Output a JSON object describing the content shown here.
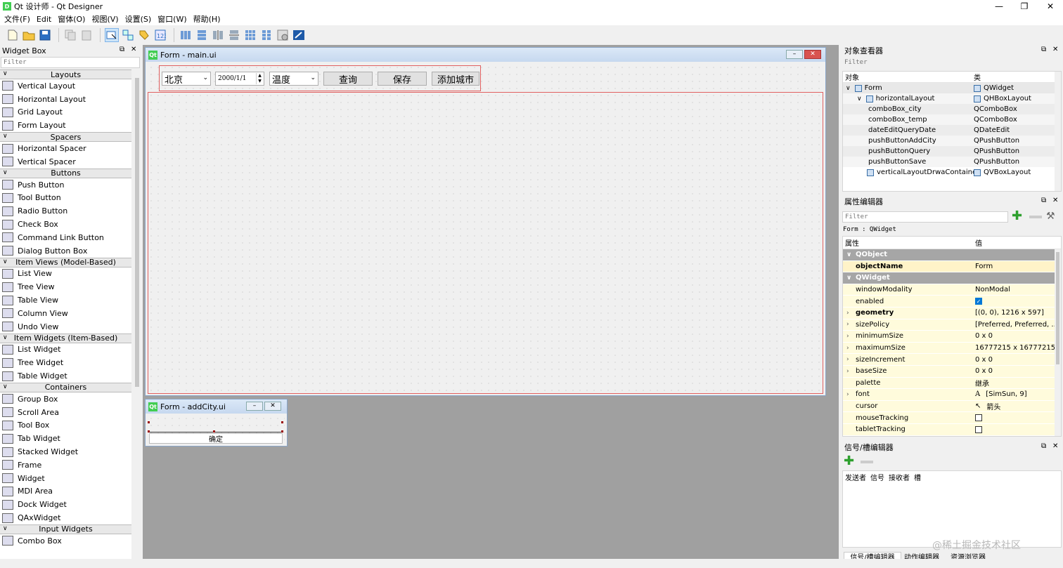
{
  "window": {
    "title": "Qt 设计师 - Qt Designer",
    "app_icon": "D",
    "minimize": "—",
    "restore": "❐",
    "close": "✕"
  },
  "menu": [
    "文件(F)",
    "Edit",
    "窗体(O)",
    "视图(V)",
    "设置(S)",
    "窗口(W)",
    "帮助(H)"
  ],
  "widget_box": {
    "title": "Widget Box",
    "filter_placeholder": "Filter",
    "categories": [
      {
        "name": "Layouts",
        "items": [
          "Vertical Layout",
          "Horizontal Layout",
          "Grid Layout",
          "Form Layout"
        ]
      },
      {
        "name": "Spacers",
        "items": [
          "Horizontal Spacer",
          "Vertical Spacer"
        ]
      },
      {
        "name": "Buttons",
        "items": [
          "Push Button",
          "Tool Button",
          "Radio Button",
          "Check Box",
          "Command Link Button",
          "Dialog Button Box"
        ]
      },
      {
        "name": "Item Views (Model-Based)",
        "items": [
          "List View",
          "Tree View",
          "Table View",
          "Column View",
          "Undo View"
        ]
      },
      {
        "name": "Item Widgets (Item-Based)",
        "items": [
          "List Widget",
          "Tree Widget",
          "Table Widget"
        ]
      },
      {
        "name": "Containers",
        "items": [
          "Group Box",
          "Scroll Area",
          "Tool Box",
          "Tab Widget",
          "Stacked Widget",
          "Frame",
          "Widget",
          "MDI Area",
          "Dock Widget",
          "QAxWidget"
        ]
      },
      {
        "name": "Input Widgets",
        "items": [
          "Combo Box"
        ]
      }
    ]
  },
  "main_form": {
    "title": "Form - main.ui",
    "combo_city": "北京",
    "date_edit": "2000/1/1",
    "combo_temp": "温度",
    "btn_query": "查询",
    "btn_save": "保存",
    "btn_add_city": "添加城市"
  },
  "add_city_form": {
    "title": "Form - addCity.ui",
    "btn_ok": "确定"
  },
  "object_inspector": {
    "title": "对象查看器",
    "filter_placeholder": "Filter",
    "col_object": "对象",
    "col_class": "类",
    "rows": [
      {
        "name": "Form",
        "class": "QWidget",
        "depth": 0,
        "arrow": "∨"
      },
      {
        "name": "horizontalLayout",
        "class": "QHBoxLayout",
        "depth": 1,
        "arrow": "∨"
      },
      {
        "name": "comboBox_city",
        "class": "QComboBox",
        "depth": 2,
        "arrow": ""
      },
      {
        "name": "comboBox_temp",
        "class": "QComboBox",
        "depth": 2,
        "arrow": ""
      },
      {
        "name": "dateEditQueryDate",
        "class": "QDateEdit",
        "depth": 2,
        "arrow": ""
      },
      {
        "name": "pushButtonAddCity",
        "class": "QPushButton",
        "depth": 2,
        "arrow": ""
      },
      {
        "name": "pushButtonQuery",
        "class": "QPushButton",
        "depth": 2,
        "arrow": ""
      },
      {
        "name": "pushButtonSave",
        "class": "QPushButton",
        "depth": 2,
        "arrow": ""
      },
      {
        "name": "verticalLayoutDrwaContainer",
        "class": "QVBoxLayout",
        "depth": 1,
        "arrow": ""
      }
    ]
  },
  "property_editor": {
    "title": "属性编辑器",
    "filter_placeholder": "Filter",
    "context": "Form : QWidget",
    "col_prop": "属性",
    "col_value": "值",
    "group_qobject": "QObject",
    "group_qwidget": "QWidget",
    "object_name": {
      "name": "objectName",
      "value": "Form"
    },
    "rows": [
      {
        "name": "windowModality",
        "value": "NonModal",
        "bold": false,
        "arrow": false,
        "kind": "text"
      },
      {
        "name": "enabled",
        "value": "",
        "bold": false,
        "arrow": false,
        "kind": "check_on"
      },
      {
        "name": "geometry",
        "value": "[(0, 0), 1216 x 597]",
        "bold": true,
        "arrow": true,
        "kind": "text"
      },
      {
        "name": "sizePolicy",
        "value": "[Preferred, Preferred, ...",
        "bold": false,
        "arrow": true,
        "kind": "text"
      },
      {
        "name": "minimumSize",
        "value": "0 x 0",
        "bold": false,
        "arrow": true,
        "kind": "text"
      },
      {
        "name": "maximumSize",
        "value": "16777215 x 16777215",
        "bold": false,
        "arrow": true,
        "kind": "text"
      },
      {
        "name": "sizeIncrement",
        "value": "0 x 0",
        "bold": false,
        "arrow": true,
        "kind": "text"
      },
      {
        "name": "baseSize",
        "value": "0 x 0",
        "bold": false,
        "arrow": true,
        "kind": "text"
      },
      {
        "name": "palette",
        "value": "继承",
        "bold": false,
        "arrow": false,
        "kind": "text"
      },
      {
        "name": "font",
        "value": "[SimSun, 9]",
        "bold": false,
        "arrow": true,
        "kind": "font"
      },
      {
        "name": "cursor",
        "value": "箭头",
        "bold": false,
        "arrow": false,
        "kind": "cursor"
      },
      {
        "name": "mouseTracking",
        "value": "",
        "bold": false,
        "arrow": false,
        "kind": "check_off"
      },
      {
        "name": "tabletTracking",
        "value": "",
        "bold": false,
        "arrow": false,
        "kind": "check_off"
      }
    ]
  },
  "signal_slot": {
    "title": "信号/槽编辑器",
    "cols": [
      "发送者",
      "信号",
      "接收者",
      "槽"
    ]
  },
  "bottom_tabs": [
    "信号/槽编辑器",
    "动作编辑器",
    "资源浏览器"
  ],
  "watermark": "@稀土掘金技术社区",
  "colors": {
    "accent": "#0078d7",
    "qt_green": "#41cd52",
    "group_header": "#a6a6a6",
    "prop_highlight": "#fff3c8",
    "layout_red": "#e06060"
  }
}
